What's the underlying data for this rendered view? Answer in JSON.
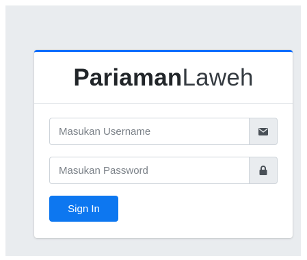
{
  "brand": {
    "bold": "Pariaman",
    "light": "Laweh"
  },
  "form": {
    "username": {
      "placeholder": "Masukan Username",
      "value": "",
      "icon": "envelope-icon"
    },
    "password": {
      "placeholder": "Masukan Password",
      "value": "",
      "icon": "lock-icon"
    },
    "submit_label": "Sign In"
  },
  "colors": {
    "accent": "#0d6efd",
    "button": "#0d77f0",
    "background": "#e9ecef"
  }
}
